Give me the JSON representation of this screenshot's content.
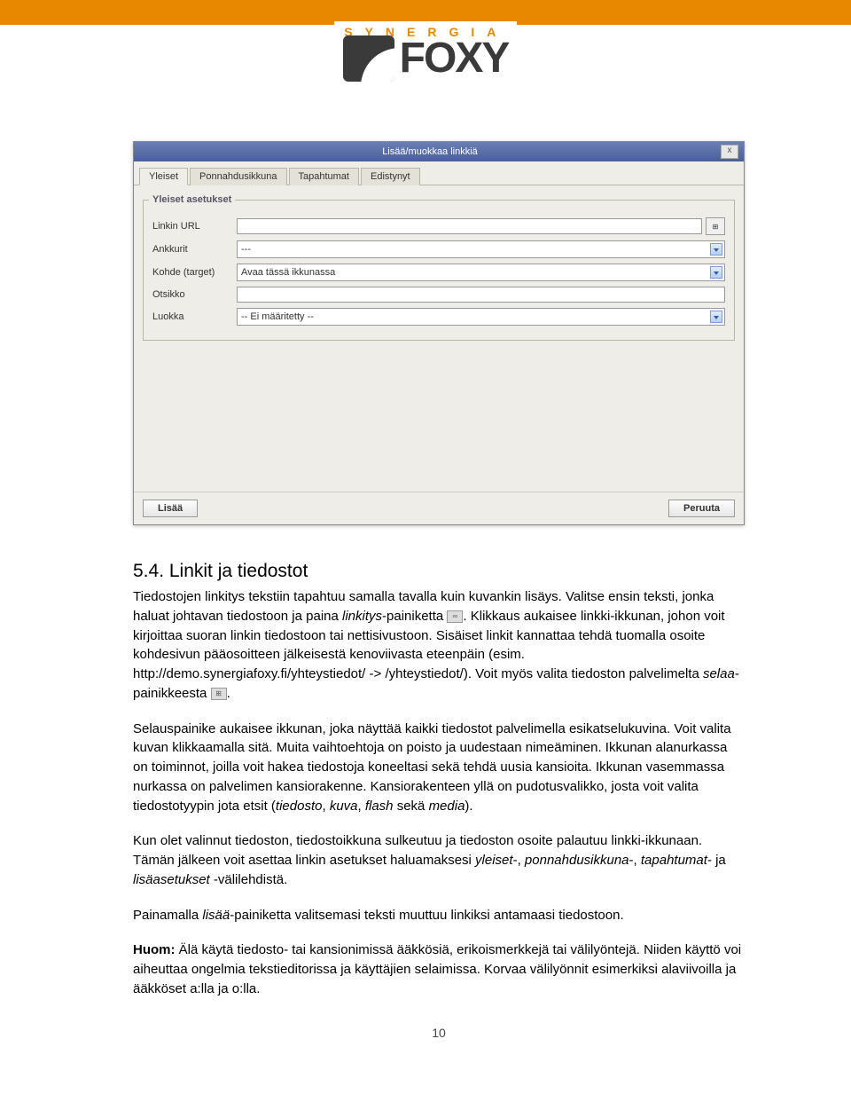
{
  "logo": {
    "tagline": "SYNERGIA",
    "word": "FOXY"
  },
  "dialog": {
    "title": "Lisää/muokkaa linkkiä",
    "close": "x",
    "tabs": [
      "Yleiset",
      "Ponnahdusikkuna",
      "Tapahtumat",
      "Edistynyt"
    ],
    "legend": "Yleiset asetukset",
    "fields": {
      "url_label": "Linkin URL",
      "url_value": "",
      "browse_glyph": "⊞",
      "anchor_label": "Ankkurit",
      "anchor_value": "---",
      "target_label": "Kohde (target)",
      "target_value": "Avaa tässä ikkunassa",
      "title_label": "Otsikko",
      "title_value": "",
      "class_label": "Luokka",
      "class_value": "-- Ei määritetty --"
    },
    "buttons": {
      "ok": "Lisää",
      "cancel": "Peruuta"
    }
  },
  "section": {
    "heading": "5.4. Linkit ja tiedostot",
    "p1a": "Tiedostojen linkitys tekstiin tapahtuu samalla tavalla kuin kuvankin lisäys. Valitse ensin teksti, jonka haluat johtavan tiedostoon ja paina ",
    "p1b": "linkitys",
    "p1c": "-painiketta ",
    "p1d": ". Klikkaus aukaisee linkki-ikkunan, johon voit kirjoittaa suoran linkin tiedostoon tai nettisivustoon. Sisäiset linkit kannattaa tehdä tuomalla osoite kohdesivun pääosoitteen jälkeisestä kenoviivasta eteenpäin (esim. http://demo.synergiafoxy.fi/yhteystiedot/ -> /yhteystiedot/). Voit myös valita tiedoston palvelimelta ",
    "p1e": "selaa",
    "p1f": "-painikkeesta ",
    "p1g": ".",
    "link_icon_glyph": "∞",
    "browse_icon_glyph": "⊞",
    "p2a": "Selauspainike aukaisee ikkunan, joka näyttää kaikki tiedostot palvelimella esikatselukuvina. Voit valita kuvan klikkaamalla sitä. Muita vaihtoehtoja on poisto ja uudestaan nimeäminen. Ikkunan alanurkassa on toiminnot, joilla voit hakea tiedostoja koneeltasi sekä tehdä uusia kansioita. Ikkunan vasemmassa nurkassa on palvelimen kansiorakenne. Kansiorakenteen yllä on pudotusvalikko, josta voit valita tiedostotyypin jota etsit (",
    "p2b": "tiedosto",
    "p2c": ", ",
    "p2d": "kuva",
    "p2e": ", ",
    "p2f": "flash",
    "p2g": " sekä ",
    "p2h": "media",
    "p2i": ").",
    "p3a": "Kun olet valinnut tiedoston, tiedostoikkuna sulkeutuu ja tiedoston osoite palautuu linkki-ikkunaan. Tämän jälkeen voit asettaa linkin asetukset haluamaksesi ",
    "p3b": "yleiset",
    "p3c": "-, ",
    "p3d": "ponnahdusikkuna",
    "p3e": "-, ",
    "p3f": "tapahtumat",
    "p3g": "- ja ",
    "p3h": "lisäasetukset",
    "p3i": " -välilehdistä.",
    "p4a": "Painamalla ",
    "p4b": "lisää",
    "p4c": "-painiketta valitsemasi teksti muuttuu linkiksi antamaasi tiedostoon.",
    "p5a": "Huom:",
    "p5b": " Älä käytä tiedosto- tai kansionimissä ääkkösiä, erikoismerkkejä tai välilyöntejä. Niiden käyttö voi aiheuttaa ongelmia tekstieditorissa ja käyttäjien selaimissa. Korvaa välilyönnit esimerkiksi alaviivoilla ja ääkköset a:lla ja o:lla."
  },
  "page_number": "10"
}
